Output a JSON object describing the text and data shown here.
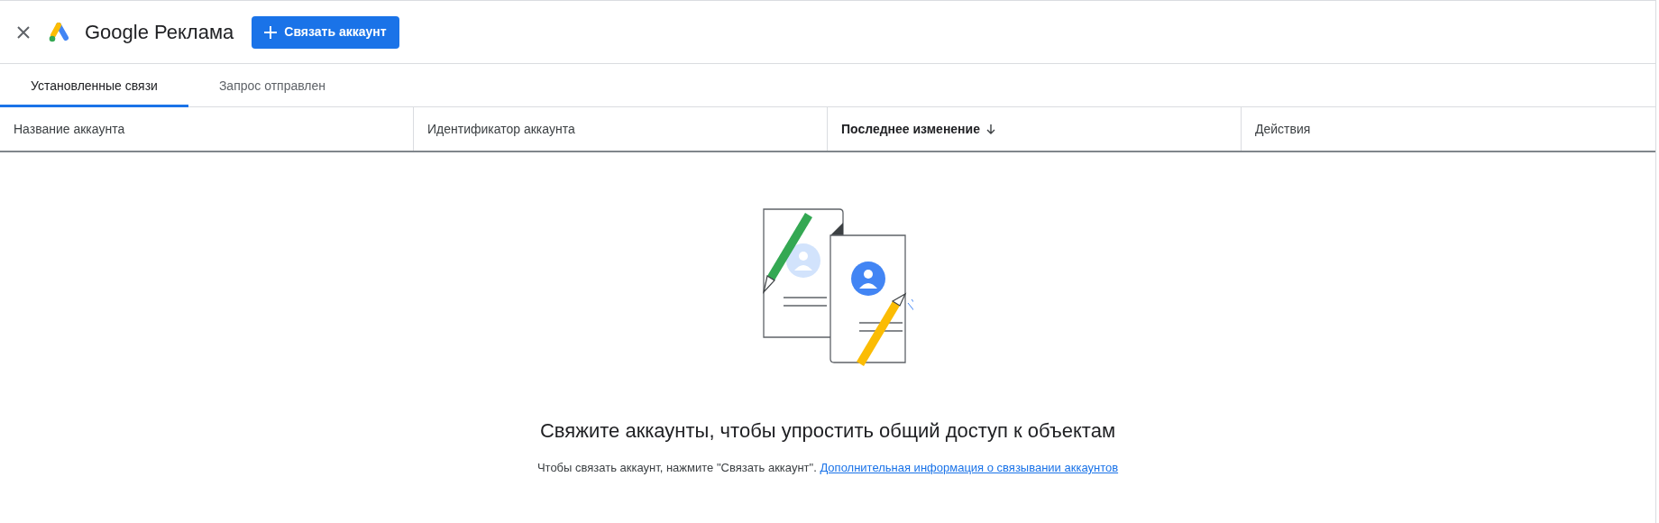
{
  "header": {
    "title": "Google Реклама",
    "button": "Связать аккаунт"
  },
  "tabs": [
    {
      "label": "Установленные связи",
      "selected": true
    },
    {
      "label": "Запрос отправлен",
      "selected": false
    }
  ],
  "table": {
    "columns": [
      {
        "label": "Название аккаунта",
        "sorted": false
      },
      {
        "label": "Идентификатор аккаунта",
        "sorted": false
      },
      {
        "label": "Последнее изменение",
        "sorted": true
      },
      {
        "label": "Действия",
        "sorted": false
      }
    ]
  },
  "empty_state": {
    "heading": "Свяжите аккаунты, чтобы упростить общий доступ к объектам",
    "text": "Чтобы связать аккаунт, нажмите \"Связать аккаунт\".",
    "link": "Дополнительная информация о связывании аккаунтов"
  }
}
